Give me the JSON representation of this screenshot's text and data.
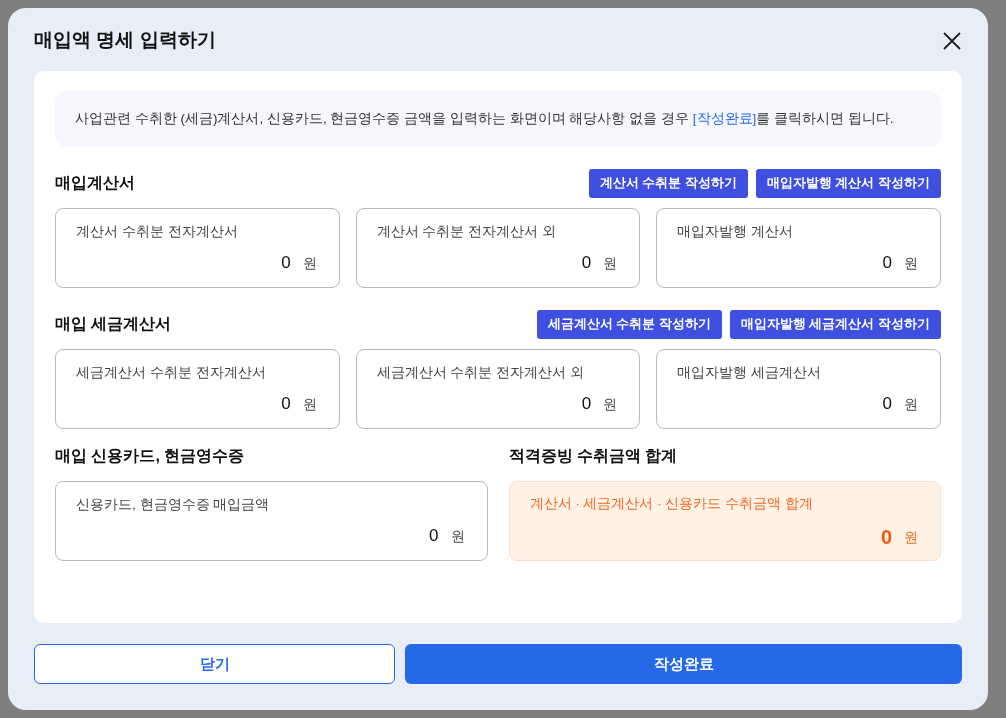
{
  "dialog": {
    "title": "매입액 명세 입력하기",
    "notice": {
      "before": "사업관련 수취한 (세금)계산서, 신용카드, 현금영수증 금액을 입력하는 화면이며 해당사항 없을 경우 ",
      "link": "[작성완료]",
      "after": "를 클릭하시면 됩니다."
    },
    "sections": [
      {
        "title": "매입계산서",
        "actions": [
          "계산서 수취분 작성하기",
          "매입자발행 계산서 작성하기"
        ],
        "fields": [
          {
            "kind": "input",
            "label": "계산서 수취분 전자계산서",
            "value": "0",
            "unit": "원"
          },
          {
            "kind": "input",
            "label": "계산서 수취분 전자계산서 외",
            "value": "0",
            "unit": "원"
          },
          {
            "kind": "input",
            "label": "매입자발행 계산서",
            "value": "0",
            "unit": "원"
          }
        ]
      },
      {
        "title": "매입 세금계산서",
        "actions": [
          "세금계산서 수취분 작성하기",
          "매입자발행 세금계산서 작성하기"
        ],
        "fields": [
          {
            "kind": "input",
            "label": "세금계산서 수취분 전자계산서",
            "value": "0",
            "unit": "원"
          },
          {
            "kind": "input",
            "label": "세금계산서 수취분 전자계산서 외",
            "value": "0",
            "unit": "원"
          },
          {
            "kind": "input",
            "label": "매입자발행 세금계산서",
            "value": "0",
            "unit": "원"
          }
        ]
      }
    ],
    "bottom_sections": [
      {
        "title": "매입 신용카드, 현금영수증",
        "fields": [
          {
            "kind": "input",
            "label": "신용카드, 현금영수증 매입금액",
            "value": "0",
            "unit": "원"
          }
        ]
      },
      {
        "title": "적격증빙 수취금액 합계",
        "fields": [
          {
            "kind": "total",
            "label": "계산서 · 세금계산서 · 신용카드 수취금액 합계",
            "value": "0",
            "unit": "원"
          }
        ]
      }
    ],
    "buttons": [
      {
        "kind": "secondary",
        "label": "닫기"
      },
      {
        "kind": "primary",
        "label": "작성완료"
      }
    ]
  }
}
